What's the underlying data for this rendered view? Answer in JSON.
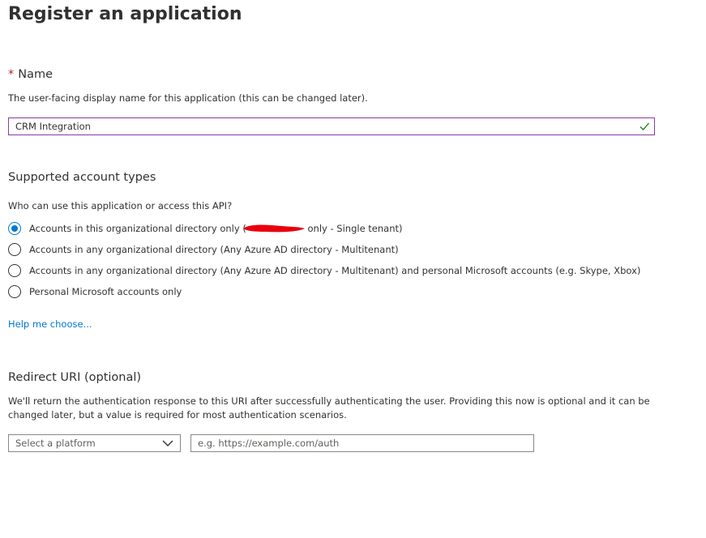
{
  "page": {
    "title": "Register an application",
    "more_label": "···"
  },
  "name_section": {
    "required_marker": "*",
    "heading": "Name",
    "description": "The user-facing display name for this application (this can be changed later).",
    "input_value": "CRM Integration",
    "valid_icon": "checkmark-icon",
    "accent_color": "#8a3aa5",
    "valid_color": "#107c10"
  },
  "account_types": {
    "heading": "Supported account types",
    "question": "Who can use this application or access this API?",
    "options": [
      {
        "label_before": "Accounts in this organizational directory only (",
        "label_after": "only - Single tenant)",
        "selected": true
      },
      {
        "label": "Accounts in any organizational directory (Any Azure AD directory - Multitenant)",
        "selected": false
      },
      {
        "label": "Accounts in any organizational directory (Any Azure AD directory - Multitenant) and personal Microsoft accounts (e.g. Skype, Xbox)",
        "selected": false
      },
      {
        "label": "Personal Microsoft accounts only",
        "selected": false
      }
    ],
    "help_link": "Help me choose...",
    "selected_color": "#0078d4",
    "link_color": "#0078d4"
  },
  "redirect": {
    "heading": "Redirect URI (optional)",
    "description_line1": "We'll return the authentication response to this URI after successfully authenticating the user. Providing this now is optional and it can be",
    "description_line2": "changed later, but a value is required for most authentication scenarios.",
    "platform_placeholder": "Select a platform",
    "platform_icon": "chevron-down-icon",
    "uri_placeholder": "e.g. https://example.com/auth"
  }
}
